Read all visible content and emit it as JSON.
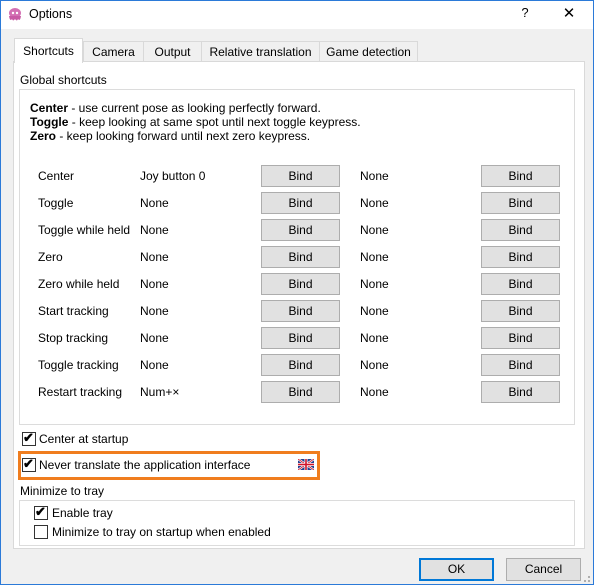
{
  "window": {
    "title": "Options",
    "help_label": "?",
    "close_label": "✕"
  },
  "tabs": [
    {
      "label": "Shortcuts",
      "active": true
    },
    {
      "label": "Camera",
      "active": false
    },
    {
      "label": "Output",
      "active": false
    },
    {
      "label": "Relative translation",
      "active": false
    },
    {
      "label": "Game detection",
      "active": false
    }
  ],
  "global_shortcuts": {
    "title": "Global shortcuts",
    "descriptions": [
      {
        "key": "Center",
        "text": " - use current pose as looking perfectly forward."
      },
      {
        "key": "Toggle",
        "text": " - keep looking at same spot until next toggle keypress."
      },
      {
        "key": "Zero",
        "text": " - keep looking forward until next zero keypress."
      }
    ],
    "rows": [
      {
        "label": "Center",
        "key1": "Joy button 0",
        "bind1": "Bind",
        "key2": "None",
        "bind2": "Bind"
      },
      {
        "label": "Toggle",
        "key1": "None",
        "bind1": "Bind",
        "key2": "None",
        "bind2": "Bind"
      },
      {
        "label": "Toggle while held",
        "key1": "None",
        "bind1": "Bind",
        "key2": "None",
        "bind2": "Bind"
      },
      {
        "label": "Zero",
        "key1": "None",
        "bind1": "Bind",
        "key2": "None",
        "bind2": "Bind"
      },
      {
        "label": "Zero while held",
        "key1": "None",
        "bind1": "Bind",
        "key2": "None",
        "bind2": "Bind"
      },
      {
        "label": "Start tracking",
        "key1": "None",
        "bind1": "Bind",
        "key2": "None",
        "bind2": "Bind"
      },
      {
        "label": "Stop tracking",
        "key1": "None",
        "bind1": "Bind",
        "key2": "None",
        "bind2": "Bind"
      },
      {
        "label": "Toggle tracking",
        "key1": "None",
        "bind1": "Bind",
        "key2": "None",
        "bind2": "Bind"
      },
      {
        "label": "Restart tracking",
        "key1": "Num+×",
        "bind1": "Bind",
        "key2": "None",
        "bind2": "Bind"
      }
    ]
  },
  "options": {
    "center_at_startup": {
      "label": "Center at startup",
      "checked": true
    },
    "never_translate": {
      "label": "Never translate the application interface",
      "checked": true
    }
  },
  "minimize_to_tray": {
    "title": "Minimize to tray",
    "enable_tray": {
      "label": "Enable tray",
      "checked": true
    },
    "minimize_on_startup": {
      "label": "Minimize to tray on startup when enabled",
      "checked": false
    }
  },
  "footer": {
    "ok_label": "OK",
    "cancel_label": "Cancel"
  },
  "colors": {
    "highlight": "#f07d1e",
    "accent": "#0078d7"
  }
}
